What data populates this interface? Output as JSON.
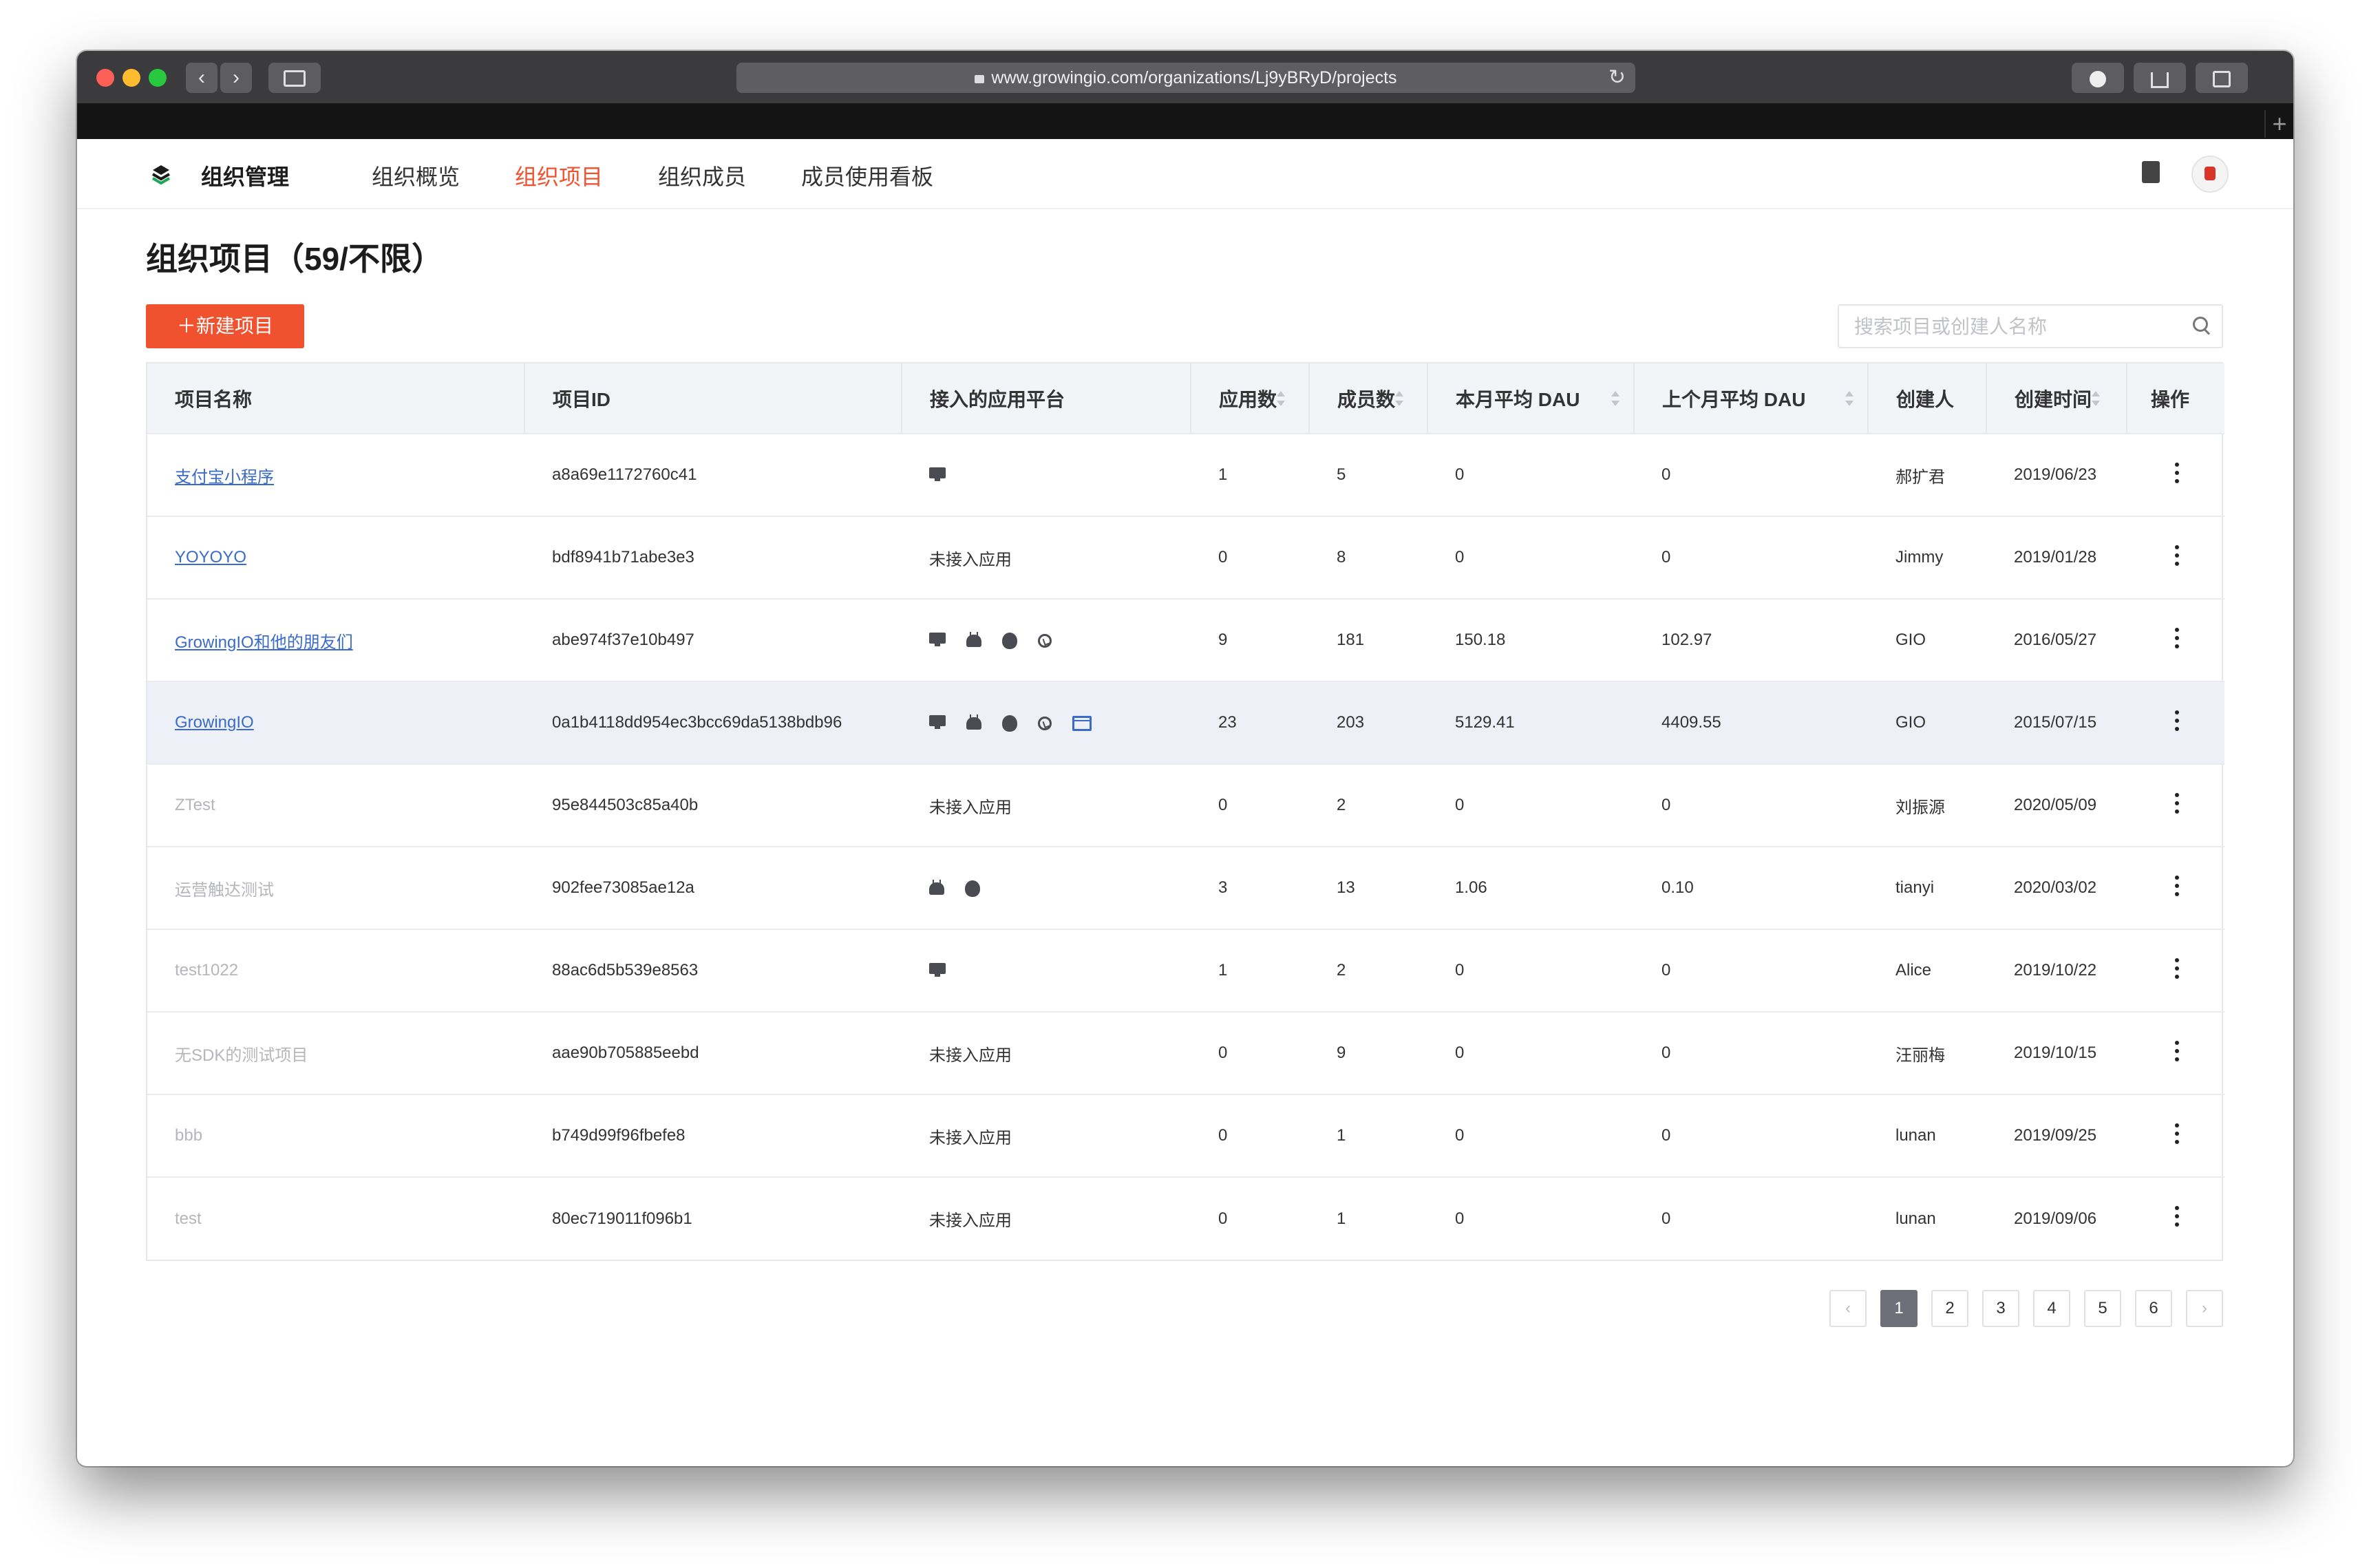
{
  "browser": {
    "url": "www.growingio.com/organizations/Lj9yBRyD/projects",
    "back": "‹",
    "forward": "›"
  },
  "nav": {
    "brand": "组织管理",
    "items": [
      {
        "label": "组织概览",
        "active": false
      },
      {
        "label": "组织项目",
        "active": true
      },
      {
        "label": "组织成员",
        "active": false
      },
      {
        "label": "成员使用看板",
        "active": false
      }
    ]
  },
  "page": {
    "title": "组织项目（59/不限）",
    "new_button": "新建项目",
    "search_placeholder": "搜索项目或创建人名称"
  },
  "table": {
    "columns": [
      "项目名称",
      "项目ID",
      "接入的应用平台",
      "应用数",
      "成员数",
      "本月平均 DAU",
      "上个月平均 DAU",
      "创建人",
      "创建时间",
      "操作"
    ],
    "rows": [
      {
        "name": "支付宝小程序",
        "id": "a8a69e1172760c41",
        "platforms": [
          "web"
        ],
        "platform_text": "",
        "apps": "1",
        "members": "5",
        "dau": "0",
        "prev_dau": "0",
        "creator": "郝扩君",
        "created": "2019/06/23",
        "link": true,
        "highlight": false
      },
      {
        "name": "YOYOYO",
        "id": "bdf8941b71abe3e3",
        "platforms": [],
        "platform_text": "未接入应用",
        "apps": "0",
        "members": "8",
        "dau": "0",
        "prev_dau": "0",
        "creator": "Jimmy",
        "created": "2019/01/28",
        "link": true,
        "highlight": false
      },
      {
        "name": "GrowingIO和他的朋友们",
        "id": "abe974f37e10b497",
        "platforms": [
          "web",
          "android",
          "ios",
          "mini"
        ],
        "platform_text": "",
        "apps": "9",
        "members": "181",
        "dau": "150.18",
        "prev_dau": "102.97",
        "creator": "GIO",
        "created": "2016/05/27",
        "link": true,
        "highlight": false
      },
      {
        "name": "GrowingIO",
        "id": "0a1b4118dd954ec3bcc69da5138bdb96",
        "platforms": [
          "web",
          "android",
          "ios",
          "mini",
          "h5"
        ],
        "platform_text": "",
        "apps": "23",
        "members": "203",
        "dau": "5129.41",
        "prev_dau": "4409.55",
        "creator": "GIO",
        "created": "2015/07/15",
        "link": true,
        "highlight": true
      },
      {
        "name": "ZTest",
        "id": "95e844503c85a40b",
        "platforms": [],
        "platform_text": "未接入应用",
        "apps": "0",
        "members": "2",
        "dau": "0",
        "prev_dau": "0",
        "creator": "刘振源",
        "created": "2020/05/09",
        "link": false,
        "highlight": false
      },
      {
        "name": "运营触达测试",
        "id": "902fee73085ae12a",
        "platforms": [
          "android",
          "ios"
        ],
        "platform_text": "",
        "apps": "3",
        "members": "13",
        "dau": "1.06",
        "prev_dau": "0.10",
        "creator": "tianyi",
        "created": "2020/03/02",
        "link": false,
        "highlight": false
      },
      {
        "name": "test1022",
        "id": "88ac6d5b539e8563",
        "platforms": [
          "web"
        ],
        "platform_text": "",
        "apps": "1",
        "members": "2",
        "dau": "0",
        "prev_dau": "0",
        "creator": "Alice",
        "created": "2019/10/22",
        "link": false,
        "highlight": false
      },
      {
        "name": "无SDK的测试项目",
        "id": "aae90b705885eebd",
        "platforms": [],
        "platform_text": "未接入应用",
        "apps": "0",
        "members": "9",
        "dau": "0",
        "prev_dau": "0",
        "creator": "汪丽梅",
        "created": "2019/10/15",
        "link": false,
        "highlight": false
      },
      {
        "name": "bbb",
        "id": "b749d99f96fbefe8",
        "platforms": [],
        "platform_text": "未接入应用",
        "apps": "0",
        "members": "1",
        "dau": "0",
        "prev_dau": "0",
        "creator": "lunan",
        "created": "2019/09/25",
        "link": false,
        "highlight": false
      },
      {
        "name": "test",
        "id": "80ec719011f096b1",
        "platforms": [],
        "platform_text": "未接入应用",
        "apps": "0",
        "members": "1",
        "dau": "0",
        "prev_dau": "0",
        "creator": "lunan",
        "created": "2019/09/06",
        "link": false,
        "highlight": false
      }
    ]
  },
  "pagination": {
    "pages": [
      "1",
      "2",
      "3",
      "4",
      "5",
      "6"
    ],
    "current": "1",
    "prev": "‹",
    "next": "›"
  },
  "colors": {
    "accent": "#f0522f",
    "link": "#3b6bc9",
    "highlight_row": "#eef0f7"
  }
}
